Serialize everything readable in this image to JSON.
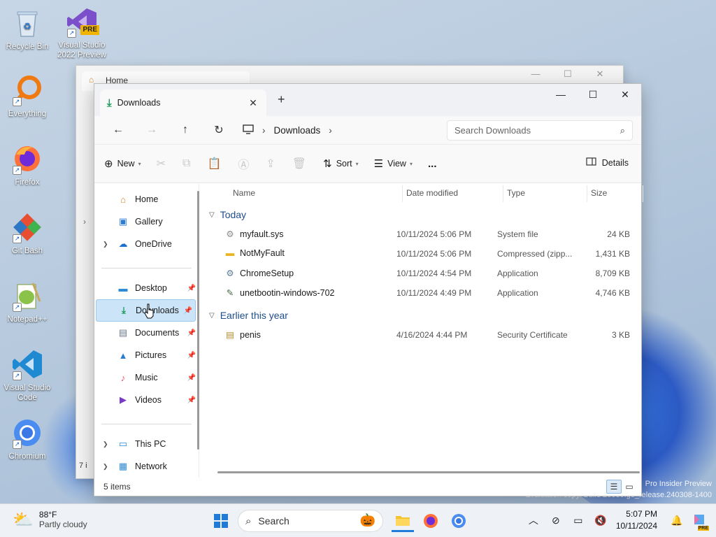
{
  "desktop": {
    "icons": [
      {
        "label": "Recycle Bin"
      },
      {
        "label": "Visual Studio 2022 Preview",
        "badge": "PRE"
      },
      {
        "label": "Everything"
      },
      {
        "label": "Firefox"
      },
      {
        "label": "Git Bash"
      },
      {
        "label": "Notepad++"
      },
      {
        "label": "Visual Studio Code"
      },
      {
        "label": "Chromium"
      }
    ],
    "watermark_line1": "Pro Insider Preview",
    "watermark_line2": "Evaluation copy. Build 26080.ge_release.240308-1400"
  },
  "back_window": {
    "tab_title": "Home",
    "status_fragment": "7 i"
  },
  "window": {
    "tab_title": "Downloads",
    "new_tab": "+",
    "breadcrumb": {
      "current": "Downloads"
    },
    "search_placeholder": "Search Downloads",
    "toolbar": {
      "new_label": "New",
      "sort_label": "Sort",
      "view_label": "View",
      "more_label": "...",
      "details_label": "Details"
    },
    "sidebar": {
      "top": [
        {
          "label": "Home"
        },
        {
          "label": "Gallery"
        },
        {
          "label": "OneDrive"
        }
      ],
      "quick": [
        {
          "label": "Desktop"
        },
        {
          "label": "Downloads"
        },
        {
          "label": "Documents"
        },
        {
          "label": "Pictures"
        },
        {
          "label": "Music"
        },
        {
          "label": "Videos"
        }
      ],
      "bottom": [
        {
          "label": "This PC"
        },
        {
          "label": "Network"
        }
      ]
    },
    "columns": {
      "name": "Name",
      "date": "Date modified",
      "type": "Type",
      "size": "Size"
    },
    "groups": [
      {
        "title": "Today",
        "files": [
          {
            "name": "myfault.sys",
            "date": "10/11/2024 5:06 PM",
            "type": "System file",
            "size": "24 KB"
          },
          {
            "name": "NotMyFault",
            "date": "10/11/2024 5:06 PM",
            "type": "Compressed (zipp...",
            "size": "1,431 KB"
          },
          {
            "name": "ChromeSetup",
            "date": "10/11/2024 4:54 PM",
            "type": "Application",
            "size": "8,709 KB"
          },
          {
            "name": "unetbootin-windows-702",
            "date": "10/11/2024 4:49 PM",
            "type": "Application",
            "size": "4,746 KB"
          }
        ]
      },
      {
        "title": "Earlier this year",
        "files": [
          {
            "name": "penis",
            "date": "4/16/2024 4:44 PM",
            "type": "Security Certificate",
            "size": "3 KB"
          }
        ]
      }
    ],
    "status": {
      "items": "5 items"
    }
  },
  "taskbar": {
    "weather_temp": "88°F",
    "weather_desc": "Partly cloudy",
    "search_label": "Search",
    "time": "5:07 PM",
    "date": "10/11/2024",
    "copilot_badge": "PRE"
  }
}
